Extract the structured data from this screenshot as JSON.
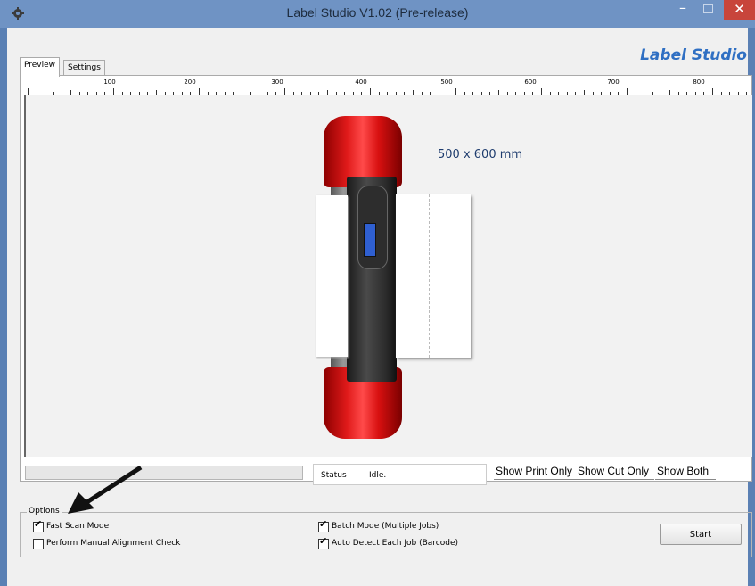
{
  "window": {
    "title": "Label Studio V1.02 (Pre-release)",
    "minimize_glyph": "–",
    "close_glyph": "✕",
    "app_icon": "gear-icon"
  },
  "brand": "Label Studio",
  "tabs": [
    {
      "label": "Preview",
      "selected": true
    },
    {
      "label": "Settings",
      "selected": false
    }
  ],
  "ruler": {
    "labels": [
      "100",
      "200",
      "300",
      "400",
      "500",
      "600",
      "700",
      "800"
    ]
  },
  "preview": {
    "dimension_label": "500 x 600 mm"
  },
  "status": {
    "key": "Status",
    "value": "Idle.",
    "progress": 0
  },
  "view_tabs": [
    {
      "label": "Show Print Only"
    },
    {
      "label": "Show Cut Only"
    },
    {
      "label": "Show Both"
    }
  ],
  "options": {
    "legend": "Options",
    "items": [
      {
        "label": "Fast Scan Mode",
        "checked": true
      },
      {
        "label": "Perform Manual Alignment Check",
        "checked": false
      },
      {
        "label": "Batch Mode (Multiple Jobs)",
        "checked": true
      },
      {
        "label": "Auto Detect Each Job (Barcode)",
        "checked": true
      }
    ],
    "check_glyph": "✔"
  },
  "actions": {
    "start_label": "Start"
  },
  "colors": {
    "titlebar": "#6f93c4",
    "brand": "#2f6fc3",
    "close": "#c8453b",
    "machine_red": "#e01a1a"
  }
}
